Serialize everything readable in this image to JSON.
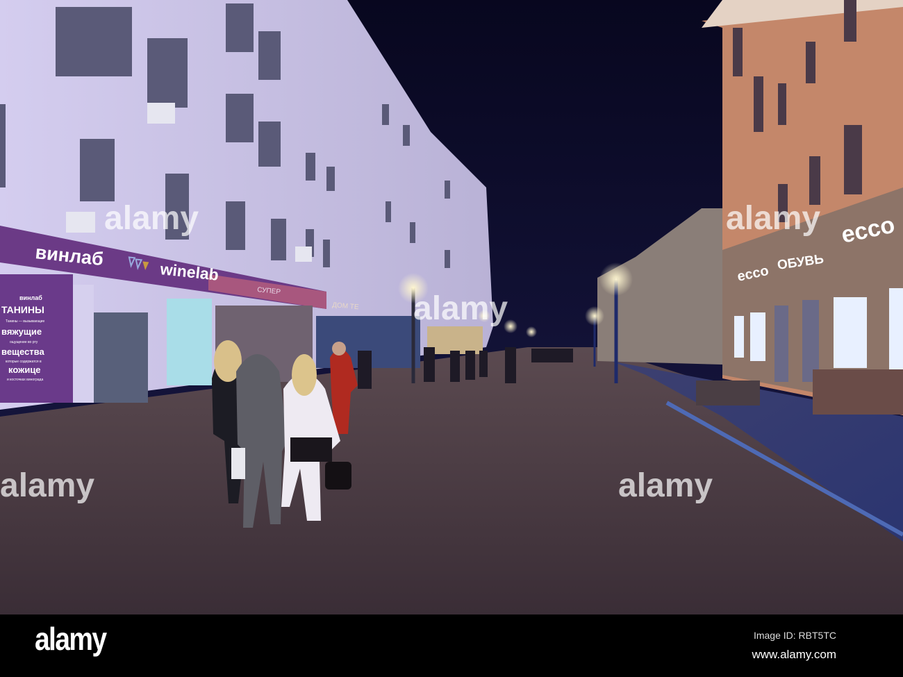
{
  "signs": {
    "winelab_ru": "винлаб",
    "winelab_en": "winelab",
    "super": "СУПЕР",
    "dom": "ДОМ ТЕ",
    "ecco_small": "ecco",
    "obuv": "ОБУВЬ",
    "ecco_big": "ecco"
  },
  "poster": {
    "brand": "винлаб",
    "lines": [
      "ТАНИНЫ",
      "Танины — вызывающие",
      "вяжущие",
      "ощущение во рту",
      "вещества",
      "которые содержатся в",
      "кожице",
      "и косточках винограда"
    ]
  },
  "watermark": "alamy",
  "footer": {
    "logo": "alamy",
    "image_id": "Image ID: RBT5TC",
    "url": "www.alamy.com"
  },
  "colors": {
    "sky": "#0b0a2a",
    "facade": "#c6bfe6",
    "sign": "#6b3a86",
    "street": "#3f3340",
    "right_building": "#c4876a"
  }
}
